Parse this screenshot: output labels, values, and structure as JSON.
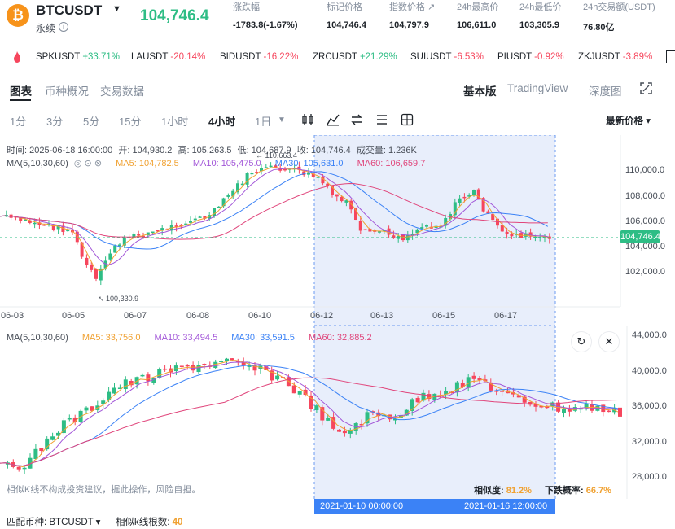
{
  "header": {
    "coin_icon_glyph": "₿",
    "symbol": "BTCUSDT",
    "contract_type": "永续",
    "last_price": "104,746.4",
    "stats": [
      {
        "label": "涨跌幅",
        "value": "-1783.8(-1.67%)",
        "color": "#2ebd85"
      },
      {
        "label": "标记价格",
        "value": "104,746.4"
      },
      {
        "label": "指数价格 ↗",
        "value": "104,797.9"
      },
      {
        "label": "24h最高价",
        "value": "106,611.0"
      },
      {
        "label": "24h最低价",
        "value": "103,305.9"
      },
      {
        "label": "24h交易额(USDT)",
        "value": "76.80亿"
      }
    ]
  },
  "ticker": [
    {
      "symbol": "SPKUSDT",
      "change": "+33.71%",
      "dir": "up"
    },
    {
      "symbol": "LAUSDT",
      "change": "-20.14%",
      "dir": "down"
    },
    {
      "symbol": "BIDUSDT",
      "change": "-16.22%",
      "dir": "down"
    },
    {
      "symbol": "ZRCUSDT",
      "change": "+21.29%",
      "dir": "up"
    },
    {
      "symbol": "SUIUSDT",
      "change": "-6.53%",
      "dir": "down"
    },
    {
      "symbol": "PIUSDT",
      "change": "-0.92%",
      "dir": "down"
    },
    {
      "symbol": "ZKJUSDT",
      "change": "-3.89%",
      "dir": "down"
    }
  ],
  "tabs": [
    "图表",
    "币种概况",
    "交易数据"
  ],
  "views": [
    "基本版",
    "TradingView",
    "深度图"
  ],
  "intervals": [
    "1分",
    "3分",
    "5分",
    "15分",
    "1小时",
    "4小时",
    "1日"
  ],
  "active_interval": "4小时",
  "price_type": "最新价格",
  "ohlc": {
    "time": "时间: 2025-06-18 16:00:00",
    "open": "开: 104,930.2",
    "high": "高: 105,263.5",
    "low": "低: 104,687.9",
    "close": "收: 104,746.4",
    "volume": "成交量: 1.236K"
  },
  "ma_top": {
    "label": "MA(5,10,30,60)",
    "ma5": "MA5: 104,782.5",
    "ma10": "MA10: 105,475.0",
    "ma30": "MA30: 105,631.0",
    "ma60": "MA60: 106,659.7"
  },
  "ma_bottom": {
    "label": "MA(5,10,30,60)",
    "ma5": "MA5: 33,756.0",
    "ma10": "MA10: 33,494.5",
    "ma30": "MA30: 33,591.5",
    "ma60": "MA60: 32,885.2"
  },
  "colors": {
    "up": "#2ebd85",
    "down": "#f6465d",
    "ma5": "#f0a131",
    "ma10": "#a256d8",
    "ma30": "#3b82f6",
    "ma60": "#e0457b",
    "highlight": "#e8eefb"
  },
  "top_chart": {
    "y_ticks": [
      "110,000.0",
      "108,000.0",
      "106,000.0",
      "104,000.0",
      "102,000.0"
    ],
    "x_ticks": [
      "06-03",
      "06-05",
      "06-07",
      "06-08",
      "06-10",
      "06-12",
      "06-13",
      "06-15",
      "06-17"
    ],
    "high_label": "110,663.4",
    "low_label": "100,330.9",
    "last_price_tag": "104,746.4"
  },
  "bottom_chart": {
    "y_ticks": [
      "44,000.0",
      "40,000.0",
      "36,000.0",
      "32,000.0",
      "28,000.0"
    ]
  },
  "icons": [
    "refresh-icon",
    "close-icon",
    "candle-type-icon",
    "indicator-icon",
    "swap-icon",
    "list-icon",
    "settings-icon",
    "expand-icon"
  ],
  "disclaimer": "相似K线不构成投资建议，据此操作，风险自担。",
  "similarity_label": "相似度:",
  "similarity_value": "81.2%",
  "fall_prob_label": "下跌概率:",
  "fall_prob_value": "66.7%",
  "match_start": "2021-01-10 00:00:00",
  "match_end": "2021-01-16 12:00:00",
  "footer": {
    "coin_label": "匹配币种: BTCUSDT ▾",
    "count_label": "相似k线根数:",
    "count_value": "40"
  }
}
